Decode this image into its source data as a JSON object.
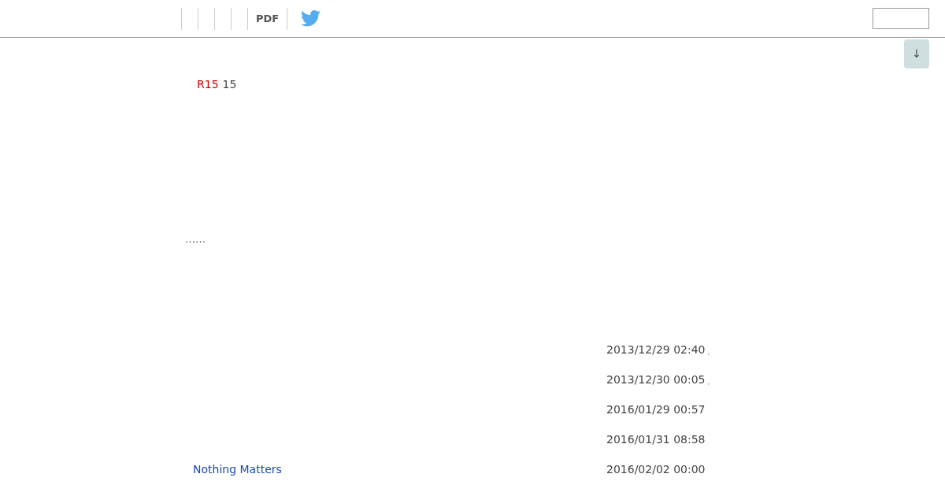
{
  "toolbar": {
    "pdf_label": "PDF"
  },
  "scroll_button": {
    "label": "↓"
  },
  "post": {
    "tag": "R15",
    "number": "15",
    "ellipsis": "……"
  },
  "entries": [
    {
      "date": "2013/12/29 02:40",
      "suffix": ","
    },
    {
      "date": "2013/12/30 00:05",
      "suffix": ","
    },
    {
      "date": "2016/01/29 00:57"
    },
    {
      "date": "2016/01/31 08:58"
    },
    {
      "link": "Nothing Matters",
      "date": "2016/02/02 00:00"
    }
  ]
}
